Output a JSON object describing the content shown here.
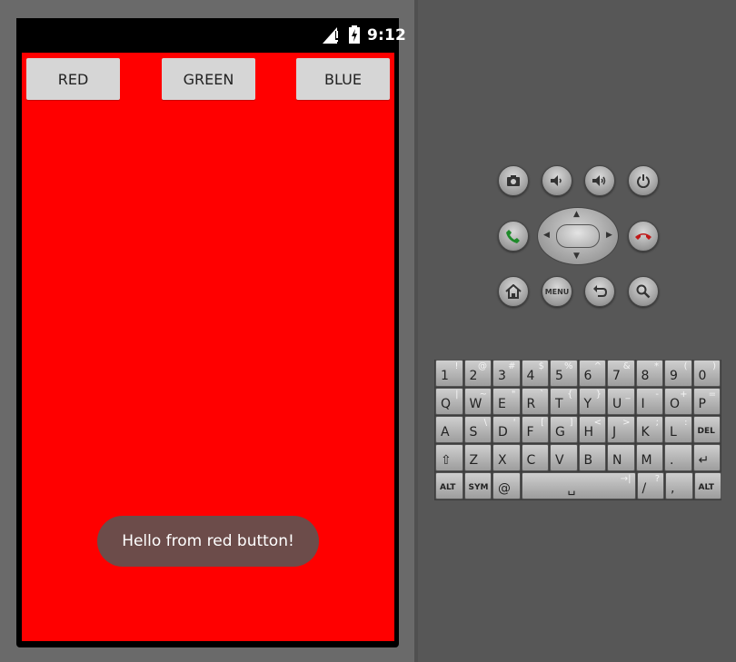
{
  "status_bar": {
    "time": "9:12"
  },
  "buttons": [
    {
      "label": "RED"
    },
    {
      "label": "GREEN"
    },
    {
      "label": "BLUE"
    }
  ],
  "toast": {
    "message": "Hello from red button!"
  },
  "colors": {
    "screen_background": "#ff0000",
    "button_background": "#d6d6d6",
    "toast_background": "#6c4c4a"
  },
  "hardware_buttons": {
    "camera": "camera-icon",
    "volume_down": "volume-down-icon",
    "volume_up": "volume-up-icon",
    "power": "power-icon",
    "call": "call-icon",
    "end_call": "end-call-icon",
    "home": "home-icon",
    "menu_label": "MENU",
    "back": "back-icon",
    "search": "search-icon"
  },
  "keyboard": {
    "rows": [
      [
        {
          "k": "1",
          "a": "!"
        },
        {
          "k": "2",
          "a": "@"
        },
        {
          "k": "3",
          "a": "#"
        },
        {
          "k": "4",
          "a": "$"
        },
        {
          "k": "5",
          "a": "%"
        },
        {
          "k": "6",
          "a": "^"
        },
        {
          "k": "7",
          "a": "&"
        },
        {
          "k": "8",
          "a": "*"
        },
        {
          "k": "9",
          "a": "("
        },
        {
          "k": "0",
          "a": ")"
        }
      ],
      [
        {
          "k": "Q",
          "a": "|"
        },
        {
          "k": "W",
          "a": "~"
        },
        {
          "k": "E",
          "a": "\""
        },
        {
          "k": "R",
          "a": "`"
        },
        {
          "k": "T",
          "a": "{"
        },
        {
          "k": "Y",
          "a": "}"
        },
        {
          "k": "U",
          "a": "_"
        },
        {
          "k": "I",
          "a": "-"
        },
        {
          "k": "O",
          "a": "+"
        },
        {
          "k": "P",
          "a": "="
        }
      ],
      [
        {
          "k": "A",
          "a": ""
        },
        {
          "k": "S",
          "a": "\\"
        },
        {
          "k": "D",
          "a": "'"
        },
        {
          "k": "F",
          "a": "["
        },
        {
          "k": "G",
          "a": "]"
        },
        {
          "k": "H",
          "a": "<"
        },
        {
          "k": "J",
          "a": ">"
        },
        {
          "k": "K",
          "a": ";"
        },
        {
          "k": "L",
          "a": ":"
        },
        {
          "k": "DEL",
          "a": ""
        }
      ],
      [
        {
          "k": "⇧",
          "a": ""
        },
        {
          "k": "Z",
          "a": ""
        },
        {
          "k": "X",
          "a": ""
        },
        {
          "k": "C",
          "a": ""
        },
        {
          "k": "V",
          "a": ""
        },
        {
          "k": "B",
          "a": ""
        },
        {
          "k": "N",
          "a": ""
        },
        {
          "k": "M",
          "a": ""
        },
        {
          "k": ".",
          "a": ""
        },
        {
          "k": "↵",
          "a": ""
        }
      ],
      [
        {
          "k": "ALT",
          "a": ""
        },
        {
          "k": "SYM",
          "a": ""
        },
        {
          "k": "@",
          "a": ""
        },
        {
          "k": "␣",
          "a": "→|"
        },
        {
          "k": "/",
          "a": "?"
        },
        {
          "k": ",",
          "a": ""
        },
        {
          "k": "ALT",
          "a": ""
        }
      ]
    ]
  }
}
